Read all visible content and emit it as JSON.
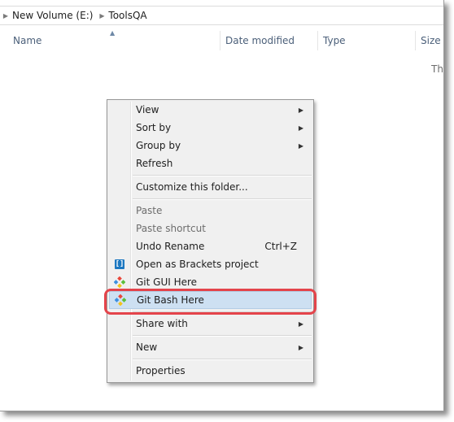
{
  "breadcrumb": {
    "items": [
      "New Volume (E:)",
      "ToolsQA"
    ]
  },
  "columns": {
    "name": "Name",
    "date_modified": "Date modified",
    "type": "Type",
    "size": "Size"
  },
  "empty_folder_hint": "This folder is empty.",
  "context_menu": {
    "items": [
      {
        "label": "View",
        "submenu": true
      },
      {
        "label": "Sort by",
        "submenu": true
      },
      {
        "label": "Group by",
        "submenu": true
      },
      {
        "label": "Refresh"
      },
      {
        "label": "Customize this folder..."
      },
      {
        "label": "Paste",
        "disabled": true
      },
      {
        "label": "Paste shortcut",
        "disabled": true
      },
      {
        "label": "Undo Rename",
        "shortcut": "Ctrl+Z"
      },
      {
        "label": "Open as Brackets project",
        "icon": "brackets-icon"
      },
      {
        "label": "Git GUI Here",
        "icon": "git-icon"
      },
      {
        "label": "Git Bash Here",
        "icon": "git-icon",
        "highlighted": true
      },
      {
        "label": "Share with",
        "submenu": true
      },
      {
        "label": "New",
        "submenu": true
      },
      {
        "label": "Properties"
      }
    ]
  },
  "colors": {
    "highlight_ring": "#e4444b",
    "selection_bg": "#cde0f2",
    "menu_bg": "#f0f0f0",
    "header_text": "#4c607a"
  }
}
